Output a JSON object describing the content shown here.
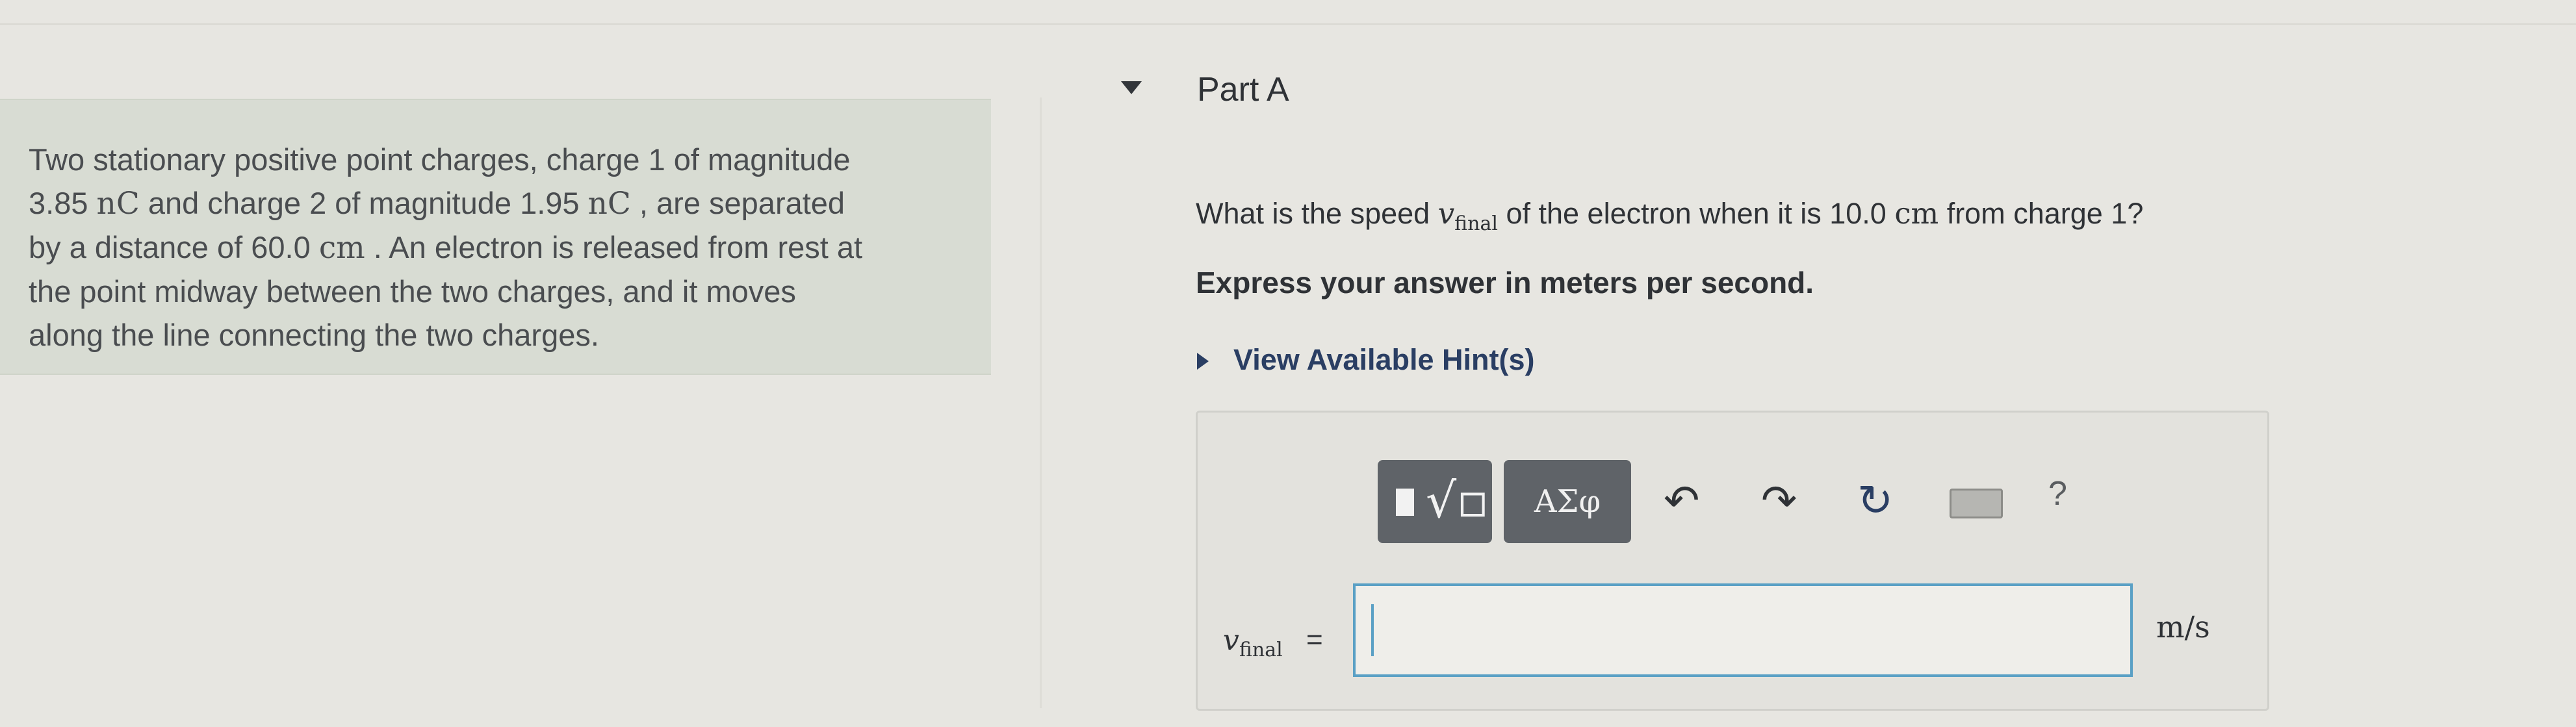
{
  "problem": {
    "line1": "Two stationary positive point charges, charge 1 of magnitude",
    "line2_a": "3.85 ",
    "line2_u1": "nC",
    "line2_b": " and charge 2 of magnitude 1.95 ",
    "line2_u2": "nC",
    "line2_c": " , are separated",
    "line3_a": "by a distance of 60.0 ",
    "line3_u": "cm",
    "line3_b": " . An electron is released from rest at",
    "line4": "the point midway between the two charges, and it moves",
    "line5": "along the line connecting the two charges."
  },
  "part": {
    "title": "Part A"
  },
  "question": {
    "prefix": "What is the speed ",
    "var": "v",
    "var_sub": "final",
    "middle": " of the electron when it is 10.0 ",
    "unit": "cm",
    "suffix": " from charge 1?"
  },
  "instruction": "Express your answer in meters per second.",
  "hint": {
    "label": "View Available Hint(s)"
  },
  "toolbar": {
    "templates_icon": "templates-icon",
    "greek_label": "ΑΣφ",
    "undo_icon": "undo-icon",
    "redo_icon": "redo-icon",
    "reset_icon": "reset-icon",
    "keyboard_icon": "keyboard-icon",
    "help_label": "?"
  },
  "answer": {
    "var": "v",
    "var_sub": "final",
    "equals": "=",
    "value": "",
    "unit": "m/s"
  },
  "colors": {
    "input_border": "#5aa0c5",
    "hint_link": "#2a3e63",
    "button_bg": "#5f6368"
  }
}
